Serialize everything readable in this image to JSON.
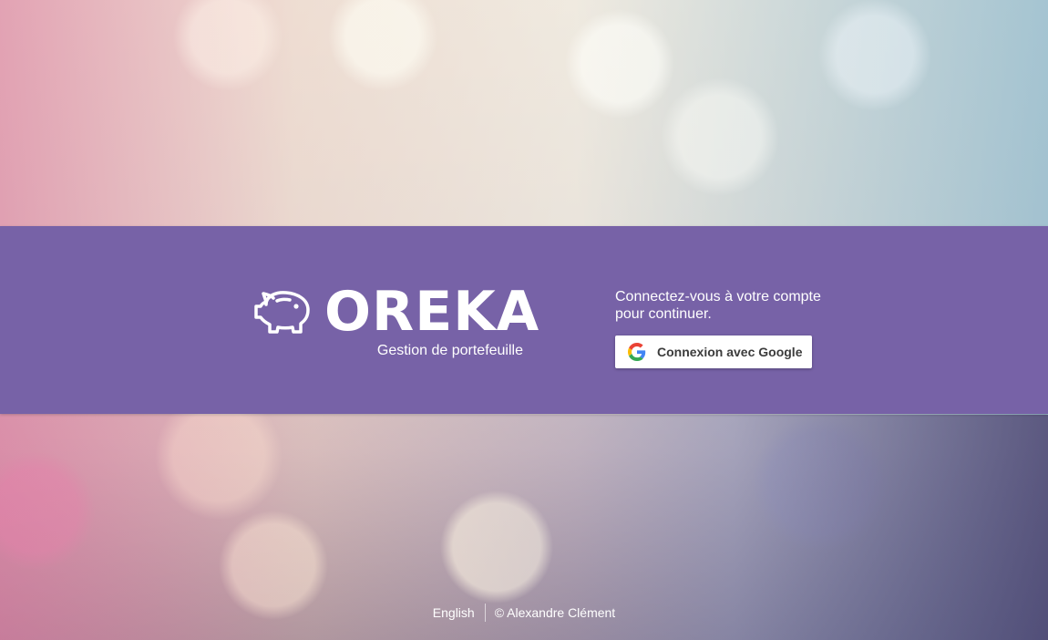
{
  "brand": {
    "logo_text": "OREKA",
    "logo_icon": "piggy-bank-icon",
    "tagline": "Gestion de portefeuille"
  },
  "login": {
    "message": "Connectez-vous à votre compte pour continuer.",
    "google_button_label": "Connexion avec Google",
    "google_icon": "google-g-icon"
  },
  "footer": {
    "language_link": "English",
    "copyright": "© Alexandre Clément"
  },
  "colors": {
    "band": "#7762a7",
    "text": "#ffffff"
  }
}
